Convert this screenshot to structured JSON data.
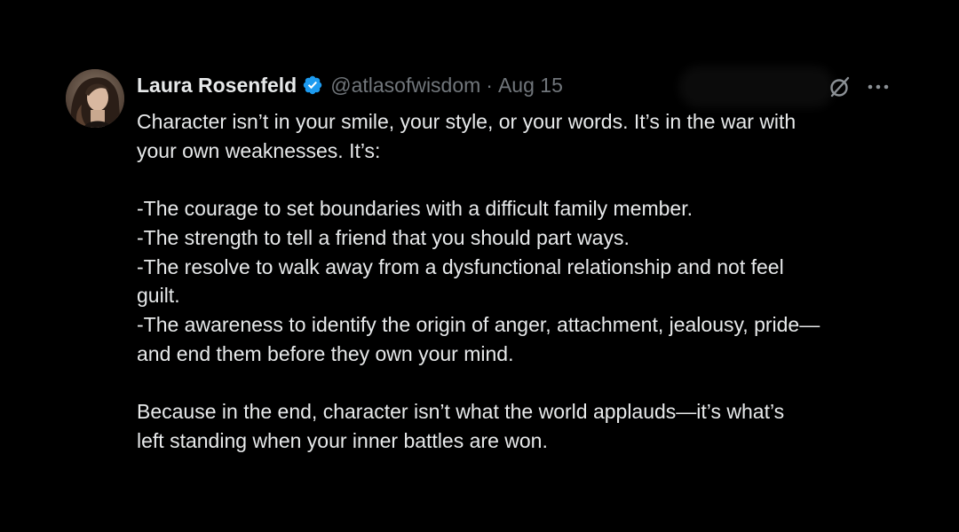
{
  "tweet": {
    "author": {
      "display_name": "Laura Rosenfeld",
      "handle": "@atlasofwisdom",
      "verified": true,
      "verified_color": "#1d9bf0"
    },
    "separator": "·",
    "date": "Aug 15",
    "icons": {
      "verified": "verified-badge-icon",
      "grok": "grok-icon",
      "more": "more-options-icon"
    },
    "text": {
      "intro_line1": "Character isn’t in your smile, your style, or your words. It’s in the war with",
      "intro_line2": "your own weaknesses. It’s:",
      "item1": "-The courage to set boundaries with a difficult family member.",
      "item2": "-The strength to tell a friend that you should part ways.",
      "item3_line1": "-The resolve to walk away from a dysfunctional relationship and not feel",
      "item3_line2": "guilt.",
      "item4_line1": "-The awareness to identify the origin of anger, attachment, jealousy, pride—",
      "item4_line2": "and end them before they own your mind.",
      "outro_line1": "Because in the end, character isn’t what the world applauds—it’s what’s",
      "outro_line2": "left standing when your inner battles are won."
    }
  },
  "colors": {
    "background": "#000000",
    "text_primary": "#e7e9ea",
    "text_secondary": "#71767b"
  }
}
